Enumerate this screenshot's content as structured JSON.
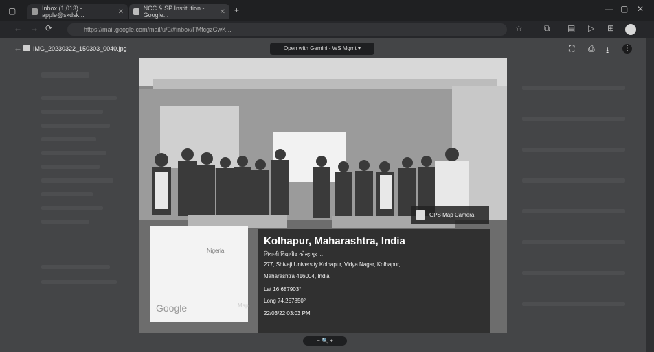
{
  "browser": {
    "tabs": [
      {
        "label": "Inbox (1,013) - apple@skdsk...",
        "active": false
      },
      {
        "label": "NCC & SP Institution - Google...",
        "active": true
      }
    ],
    "url": "https://mail.google.com/mail/u/0/#inbox/FMfcgzGwK..."
  },
  "viewer": {
    "file_name": "IMG_20230322_150303_0040.jpg",
    "open_with": "Open with Gemini - WS Mgmt ▾",
    "bottom_controls": "−  🔍  +"
  },
  "photo": {
    "gps_badge": "GPS Map Camera",
    "location_title": "Kolhapur, Maharashtra, India",
    "address_local": "शिवाजी विद्यापीठ कोल्हापूर ...",
    "address_line1": "277, Shivaji University Kolhapur, Vidya Nagar, Kolhapur,",
    "address_line2": "Maharashtra 416004, India",
    "lat": "Lat 16.687903°",
    "long": "Long 74.257850°",
    "timestamp": "22/03/22 03:03 PM",
    "map_label": "Nigeria",
    "map_brand": "Google",
    "map_side": "Map"
  }
}
